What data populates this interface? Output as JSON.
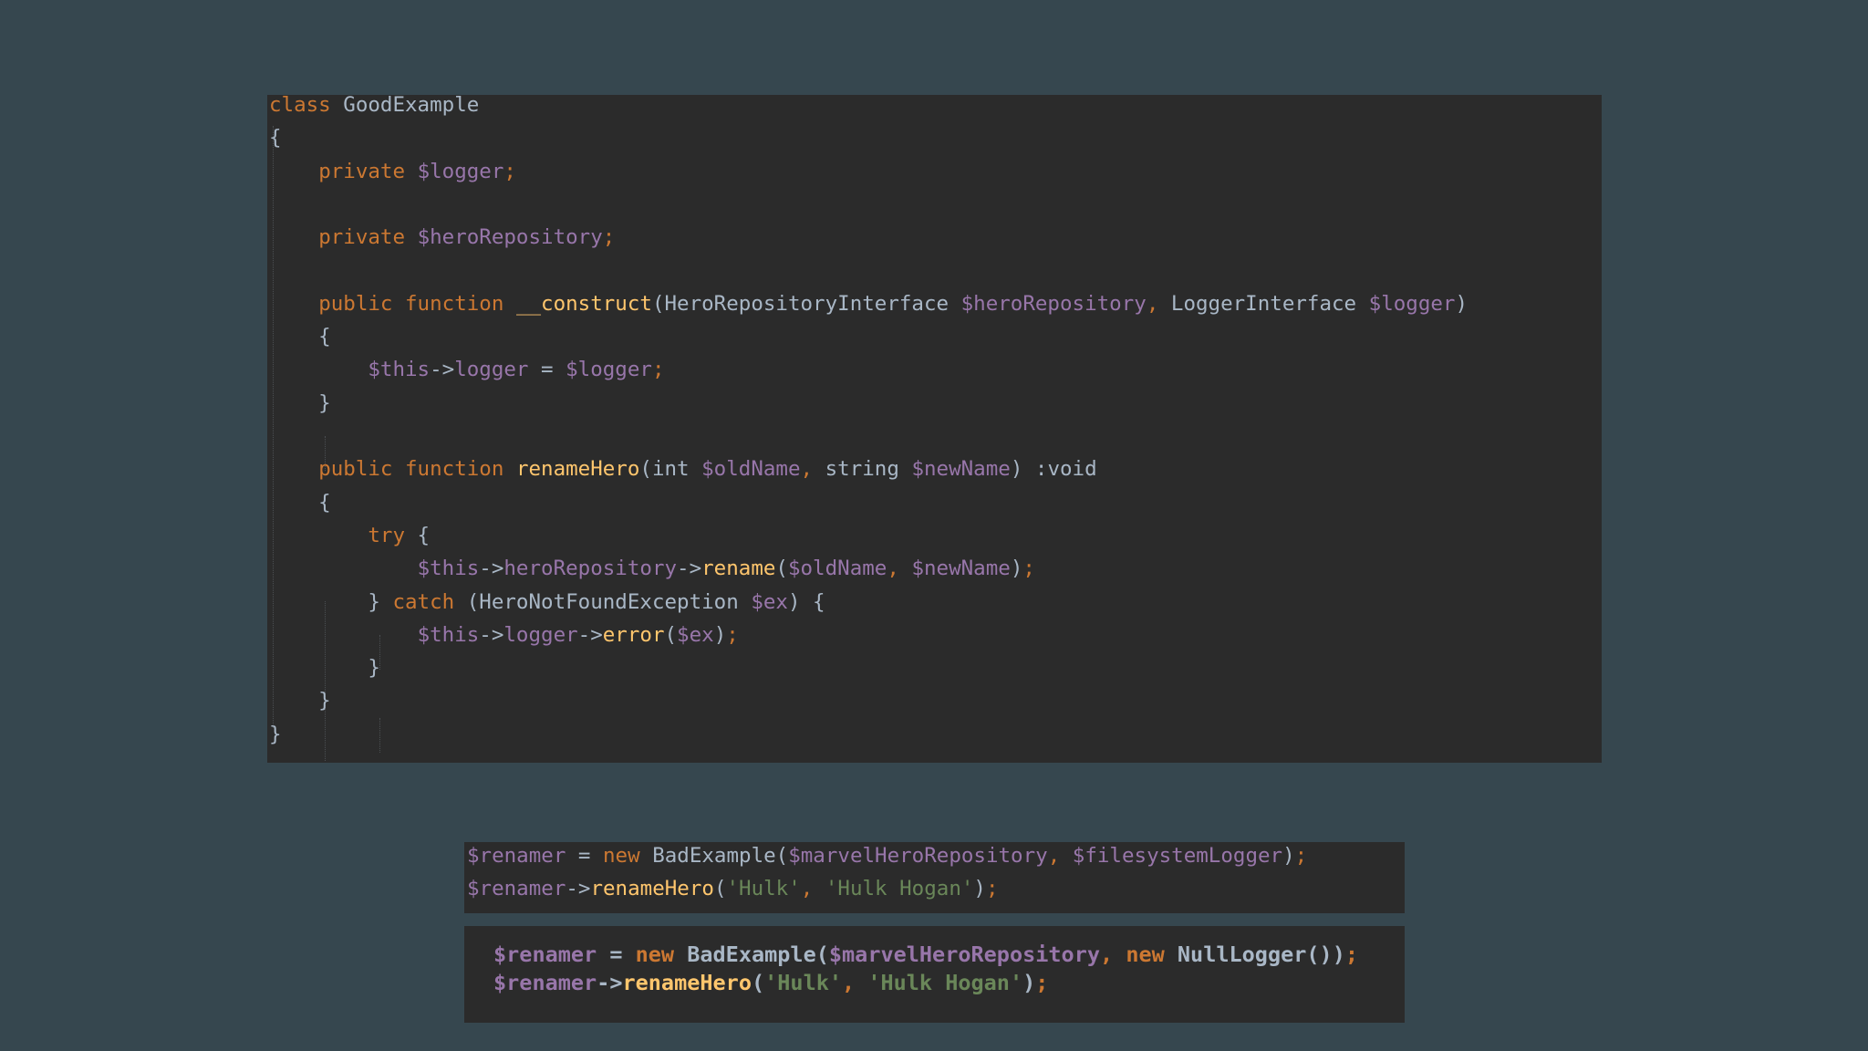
{
  "theme": {
    "background": "#36474f",
    "code_panel_background": "#2b2b2b",
    "syntax": {
      "keyword": "#cc7832",
      "variable": "#9876aa",
      "default": "#a9b7c6",
      "method": "#ffc66d",
      "string": "#6a8759"
    }
  },
  "code_panels": [
    {
      "name": "good-example-class",
      "lines": [
        [
          [
            "keyword",
            "class"
          ],
          [
            "default",
            " GoodExample"
          ]
        ],
        [
          [
            "default",
            "{"
          ]
        ],
        [
          [
            "default",
            "    "
          ],
          [
            "keyword",
            "private"
          ],
          [
            "default",
            " "
          ],
          [
            "variable",
            "$logger"
          ],
          [
            "keyword",
            ";"
          ]
        ],
        [],
        [
          [
            "default",
            "    "
          ],
          [
            "keyword",
            "private"
          ],
          [
            "default",
            " "
          ],
          [
            "variable",
            "$heroRepository"
          ],
          [
            "keyword",
            ";"
          ]
        ],
        [],
        [
          [
            "default",
            "    "
          ],
          [
            "keyword",
            "public function"
          ],
          [
            "default",
            " "
          ],
          [
            "method",
            "__construct"
          ],
          [
            "default",
            "(HeroRepositoryInterface "
          ],
          [
            "variable",
            "$heroRepository"
          ],
          [
            "keyword",
            ","
          ],
          [
            "default",
            " LoggerInterface "
          ],
          [
            "variable",
            "$logger"
          ],
          [
            "default",
            ")"
          ]
        ],
        [
          [
            "default",
            "    {"
          ]
        ],
        [
          [
            "default",
            "        "
          ],
          [
            "variable",
            "$this"
          ],
          [
            "default",
            "->"
          ],
          [
            "variable",
            "logger"
          ],
          [
            "default",
            " = "
          ],
          [
            "variable",
            "$logger"
          ],
          [
            "keyword",
            ";"
          ]
        ],
        [
          [
            "default",
            "    }"
          ]
        ],
        [],
        [
          [
            "default",
            "    "
          ],
          [
            "keyword",
            "public function"
          ],
          [
            "default",
            " "
          ],
          [
            "method",
            "renameHero"
          ],
          [
            "default",
            "(int "
          ],
          [
            "variable",
            "$oldName"
          ],
          [
            "keyword",
            ","
          ],
          [
            "default",
            " string "
          ],
          [
            "variable",
            "$newName"
          ],
          [
            "default",
            ") :void"
          ]
        ],
        [
          [
            "default",
            "    {"
          ]
        ],
        [
          [
            "default",
            "        "
          ],
          [
            "keyword",
            "try"
          ],
          [
            "default",
            " {"
          ]
        ],
        [
          [
            "default",
            "            "
          ],
          [
            "variable",
            "$this"
          ],
          [
            "default",
            "->"
          ],
          [
            "variable",
            "heroRepository"
          ],
          [
            "default",
            "->"
          ],
          [
            "method",
            "rename"
          ],
          [
            "default",
            "("
          ],
          [
            "variable",
            "$oldName"
          ],
          [
            "keyword",
            ","
          ],
          [
            "default",
            " "
          ],
          [
            "variable",
            "$newName"
          ],
          [
            "default",
            ")"
          ],
          [
            "keyword",
            ";"
          ]
        ],
        [
          [
            "default",
            "        } "
          ],
          [
            "keyword",
            "catch"
          ],
          [
            "default",
            " (HeroNotFoundException "
          ],
          [
            "variable",
            "$ex"
          ],
          [
            "default",
            ") {"
          ]
        ],
        [
          [
            "default",
            "            "
          ],
          [
            "variable",
            "$this"
          ],
          [
            "default",
            "->"
          ],
          [
            "variable",
            "logger"
          ],
          [
            "default",
            "->"
          ],
          [
            "method",
            "error"
          ],
          [
            "default",
            "("
          ],
          [
            "variable",
            "$ex"
          ],
          [
            "default",
            ")"
          ],
          [
            "keyword",
            ";"
          ]
        ],
        [
          [
            "default",
            "        }"
          ]
        ],
        [
          [
            "default",
            "    }"
          ]
        ],
        [
          [
            "default",
            "}"
          ]
        ]
      ]
    },
    {
      "name": "bad-example-usage-filesystem-logger",
      "lines": [
        [
          [
            "variable",
            "$renamer"
          ],
          [
            "default",
            " = "
          ],
          [
            "keyword",
            "new"
          ],
          [
            "default",
            " BadExample("
          ],
          [
            "variable",
            "$marvelHeroRepository"
          ],
          [
            "keyword",
            ","
          ],
          [
            "default",
            " "
          ],
          [
            "variable",
            "$filesystemLogger"
          ],
          [
            "default",
            ")"
          ],
          [
            "keyword",
            ";"
          ]
        ],
        [
          [
            "variable",
            "$renamer"
          ],
          [
            "default",
            "->"
          ],
          [
            "method",
            "renameHero"
          ],
          [
            "default",
            "("
          ],
          [
            "string",
            "'Hulk'"
          ],
          [
            "keyword",
            ","
          ],
          [
            "default",
            " "
          ],
          [
            "string",
            "'Hulk Hogan'"
          ],
          [
            "default",
            ")"
          ],
          [
            "keyword",
            ";"
          ]
        ]
      ]
    },
    {
      "name": "bad-example-usage-null-logger",
      "lines": [
        [
          [
            "variable",
            "$renamer"
          ],
          [
            "default",
            " = "
          ],
          [
            "keyword",
            "new"
          ],
          [
            "default",
            " BadExample("
          ],
          [
            "variable",
            "$marvelHeroRepository"
          ],
          [
            "keyword",
            ","
          ],
          [
            "default",
            " "
          ],
          [
            "keyword",
            "new"
          ],
          [
            "default",
            " NullLogger())"
          ],
          [
            "keyword",
            ";"
          ]
        ],
        [
          [
            "variable",
            "$renamer"
          ],
          [
            "default",
            "->"
          ],
          [
            "method",
            "renameHero"
          ],
          [
            "default",
            "("
          ],
          [
            "string",
            "'Hulk'"
          ],
          [
            "keyword",
            ","
          ],
          [
            "default",
            " "
          ],
          [
            "string",
            "'Hulk Hogan'"
          ],
          [
            "default",
            ")"
          ],
          [
            "keyword",
            ";"
          ]
        ]
      ]
    }
  ]
}
